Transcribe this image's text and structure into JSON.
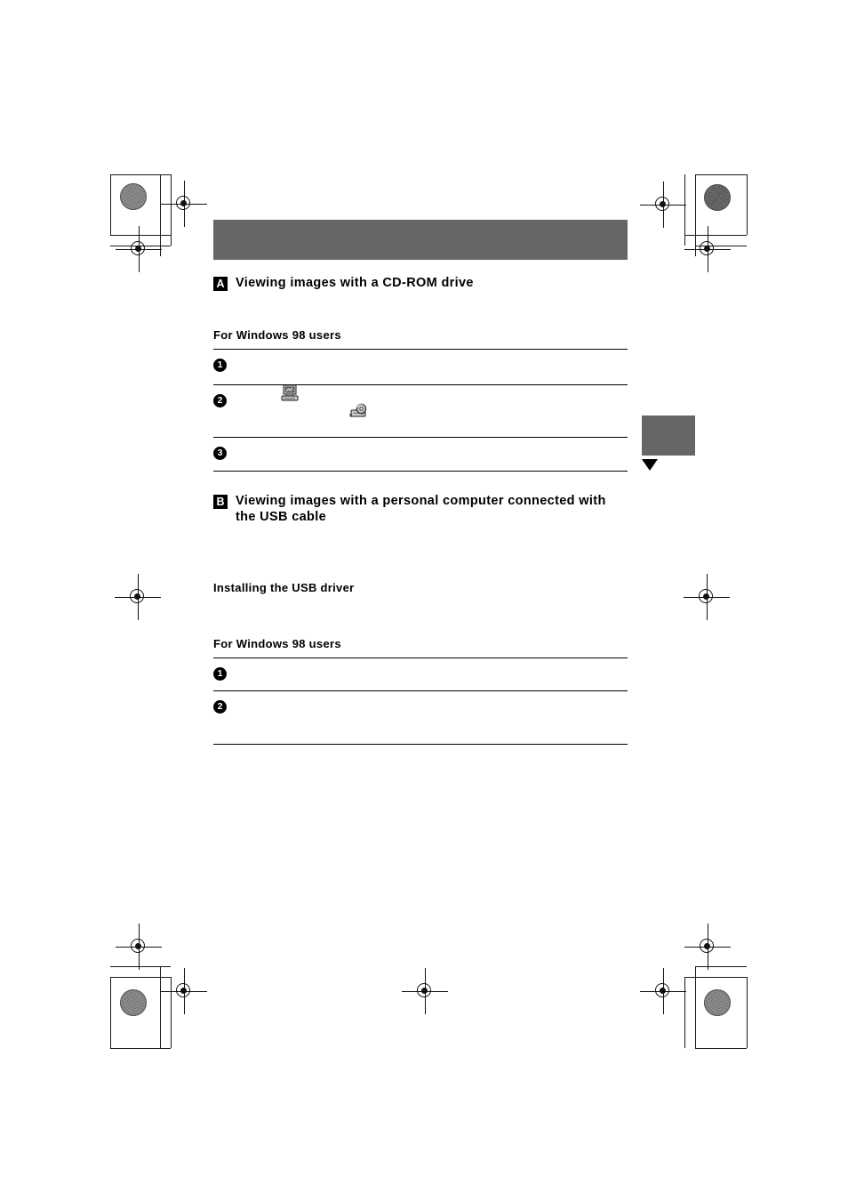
{
  "page": {
    "background_color": "#ffffff",
    "ink_color": "#000000",
    "accent_gray": "#666666"
  },
  "header_band": {
    "name": "chapter-header-band",
    "color": "#666666"
  },
  "side_tab": {
    "name": "side-thumb-tab",
    "color": "#666666",
    "arrow_glyph": "▼"
  },
  "sections": [
    {
      "badge": "A",
      "title": "Viewing images with a CD-ROM drive",
      "subhead": "For Windows 98 users",
      "steps": [
        {
          "number": "1",
          "text": ""
        },
        {
          "number": "2",
          "text": "",
          "icons": [
            {
              "name": "my-computer-icon",
              "glyph": "🖥"
            },
            {
              "name": "cd-rom-drive-icon",
              "glyph": "💿"
            }
          ]
        },
        {
          "number": "3",
          "text": ""
        }
      ]
    },
    {
      "badge": "B",
      "title": "Viewing images with a personal computer connected with the USB cable",
      "subhead_secondary": "Installing the USB driver",
      "subhead": "For Windows 98 users",
      "steps": [
        {
          "number": "1",
          "text": ""
        },
        {
          "number": "2",
          "text": ""
        }
      ]
    }
  ],
  "print_marks": {
    "registration_target_label": "registration-target",
    "density_patch_label": "density-patch",
    "crop_mark_label": "crop-mark"
  }
}
